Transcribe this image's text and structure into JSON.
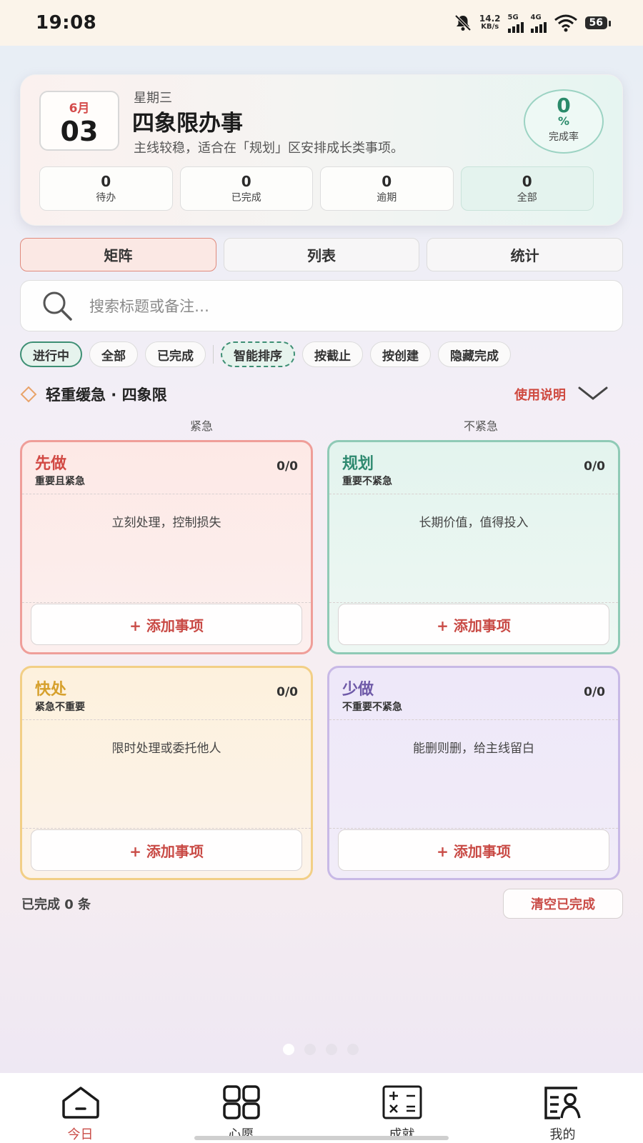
{
  "status_bar": {
    "time": "19:08",
    "net_speed_value": "14.2",
    "net_speed_unit": "KB/s",
    "sig1_label": "5G",
    "sig2_label": "4G",
    "battery": "56",
    "icons": [
      "mute-bell-icon",
      "wifi-icon",
      "battery-icon"
    ]
  },
  "header": {
    "month": "6月",
    "day": "03",
    "weekday": "星期三",
    "title": "四象限办事",
    "subtitle": "主线较稳，适合在「规划」区安排成长类事项。",
    "completion_value": "0",
    "completion_unit": "%",
    "completion_label": "完成率",
    "stats": [
      {
        "value": "0",
        "label": "待办"
      },
      {
        "value": "0",
        "label": "已完成"
      },
      {
        "value": "0",
        "label": "逾期"
      },
      {
        "value": "0",
        "label": "全部"
      }
    ]
  },
  "tabs": [
    {
      "label": "矩阵",
      "active": true
    },
    {
      "label": "列表",
      "active": false
    },
    {
      "label": "统计",
      "active": false
    }
  ],
  "search": {
    "placeholder": "搜索标题或备注…"
  },
  "filters": {
    "status": [
      "进行中",
      "全部",
      "已完成"
    ],
    "sort": [
      "智能排序",
      "按截止",
      "按创建",
      "隐藏完成"
    ]
  },
  "section": {
    "title": "轻重缓急 · 四象限",
    "help_label": "使用说明",
    "axis_urgent": "紧急",
    "axis_not_urgent": "不紧急"
  },
  "quadrants": [
    {
      "title": "先做",
      "subtitle": "重要且紧急",
      "count": "0/0",
      "hint": "立刻处理，控制损失",
      "add_label": "+ 添加事项",
      "color": "#d24a44",
      "border": "#ee9e9a"
    },
    {
      "title": "规划",
      "subtitle": "重要不紧急",
      "count": "0/0",
      "hint": "长期价值，值得投入",
      "add_label": "+ 添加事项",
      "color": "#2f8a70",
      "border": "#8fcab6"
    },
    {
      "title": "快处",
      "subtitle": "紧急不重要",
      "count": "0/0",
      "hint": "限时处理或委托他人",
      "add_label": "+ 添加事项",
      "color": "#d6a02c",
      "border": "#f2cf86"
    },
    {
      "title": "少做",
      "subtitle": "不重要不紧急",
      "count": "0/0",
      "hint": "能删则删，给主线留白",
      "add_label": "+ 添加事项",
      "color": "#6f5aa8",
      "border": "#c8b9e6"
    }
  ],
  "footer": {
    "completed_text": "已完成 0 条",
    "clear_label": "清空已完成"
  },
  "bottom_nav": [
    {
      "label": "今日",
      "icon": "home-icon",
      "active": true
    },
    {
      "label": "心愿",
      "icon": "grid-icon",
      "active": false
    },
    {
      "label": "成就",
      "icon": "calculator-icon",
      "active": false
    },
    {
      "label": "我的",
      "icon": "profile-card-icon",
      "active": false
    }
  ],
  "colors": {
    "accent_red": "#c94b46",
    "accent_green": "#3d8f74"
  }
}
